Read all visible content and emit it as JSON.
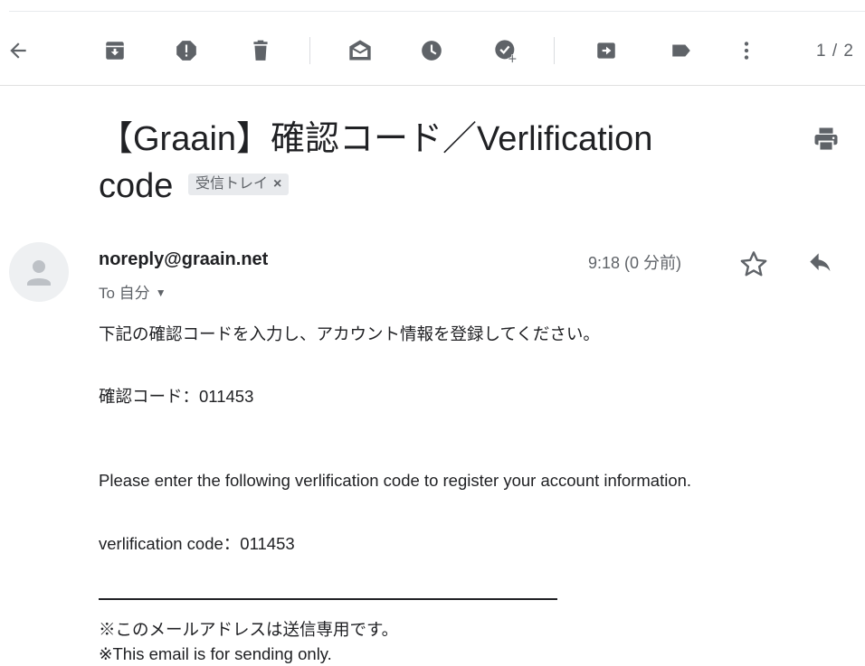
{
  "toolbar": {
    "icons": [
      "back-arrow-icon",
      "archive-icon",
      "report-spam-icon",
      "delete-icon",
      "mark-unread-icon",
      "snooze-icon",
      "add-to-tasks-icon",
      "move-to-icon",
      "label-icon",
      "more-vert-icon"
    ],
    "pager": "1 / 2"
  },
  "email": {
    "subject": "【Graain】確認コード／Verlification code",
    "label": "受信トレイ",
    "label_close": "×",
    "sender": "noreply@graain.net",
    "to": "To 自分",
    "to_caret": "▼",
    "time": "9:18 (0 分前)",
    "body": {
      "line1": "下記の確認コードを入力し、アカウント情報を登録してください。",
      "line2": "確認コード：011453",
      "line3": "Please enter the following verlification code to register your account information.",
      "line4": "verlification code：011453",
      "note1": "※このメールアドレスは送信専用です。",
      "note2": "※This email is for sending only."
    }
  },
  "colors": {
    "icon": "#5f6368",
    "text": "#202124",
    "chip_bg": "#e8eaed"
  }
}
